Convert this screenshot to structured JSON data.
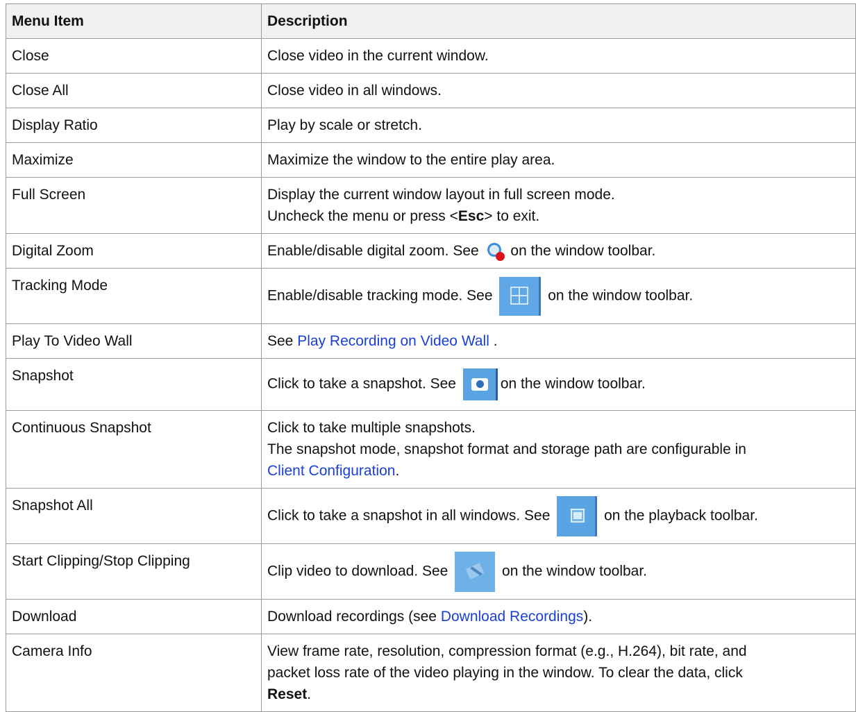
{
  "header": {
    "col1": "Menu Item",
    "col2": "Description"
  },
  "rows": [
    {
      "item": "Close",
      "desc": "Close video in the current window."
    },
    {
      "item": "Close All",
      "desc": "Close video in all windows."
    },
    {
      "item": "Display Ratio",
      "desc": "Play by scale or stretch."
    },
    {
      "item": "Maximize",
      "desc": "Maximize the window to the entire play area."
    },
    {
      "item": "Full Screen",
      "line1": "Display the current window layout in full screen mode.",
      "line2_pre": "Uncheck the menu or press <",
      "line2_bold": "Esc",
      "line2_post": "> to exit."
    },
    {
      "item": "Digital Zoom",
      "pre": "Enable/disable digital zoom. See",
      "post": "on the window toolbar.",
      "icon": "digital-zoom-icon"
    },
    {
      "item": "Tracking Mode",
      "pre": "Enable/disable tracking mode. See",
      "post": "on the window toolbar.",
      "icon": "tracking-mode-icon"
    },
    {
      "item": "Play To Video Wall",
      "pre": "See",
      "link": "Play Recording on Video Wall",
      "post": "."
    },
    {
      "item": "Snapshot",
      "pre": "Click to take a snapshot. See",
      "post": "on the window toolbar.",
      "icon": "camera-icon"
    },
    {
      "item": "Continuous Snapshot",
      "line1": "Click to take multiple snapshots.",
      "line2": "The snapshot mode, snapshot format and storage path are configurable in",
      "link": "Client Configuration",
      "post": "."
    },
    {
      "item": "Snapshot All",
      "pre": "Click to take a snapshot in all windows. See",
      "post": "on the playback toolbar.",
      "icon": "snapshot-all-icon"
    },
    {
      "item": "Start Clipping/Stop Clipping",
      "pre": "Clip video to download. See",
      "post": "on the window toolbar.",
      "icon": "scissors-icon"
    },
    {
      "item": "Download",
      "pre": "Download recordings (see",
      "link": "Download Recordings",
      "post": ")."
    },
    {
      "item": "Camera Info",
      "line1": "View frame rate, resolution, compression format (e.g., H.264), bit rate, and",
      "line2": "packet loss rate of the video playing in the window. To clear the data, click",
      "bold": "Reset",
      "post": "."
    }
  ]
}
